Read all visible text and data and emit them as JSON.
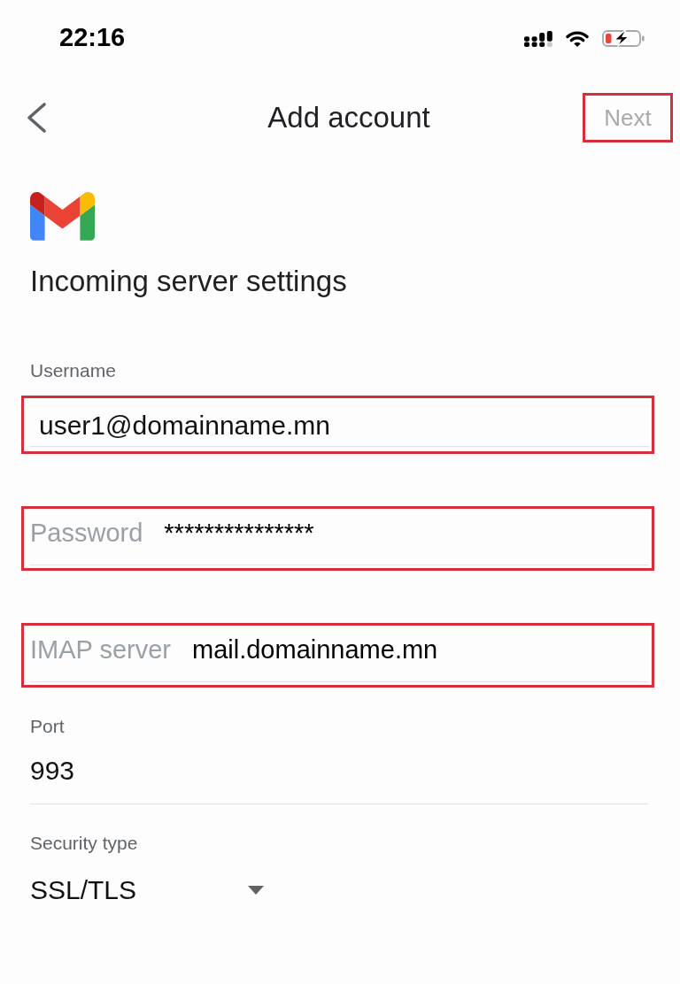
{
  "status_bar": {
    "time": "22:16"
  },
  "nav_bar": {
    "title": "Add account",
    "next_button": {
      "label": "Next",
      "disabled": true,
      "highlighted": true
    }
  },
  "heading": "Incoming server settings",
  "fields": [
    {
      "kind": "stacked",
      "label": "Username",
      "value": "user1@domainname.mn",
      "highlighted": true
    },
    {
      "kind": "inline",
      "label": "Password",
      "value": "***************",
      "highlighted": true
    },
    {
      "kind": "inline",
      "label": "IMAP server",
      "value": "mail.domainname.mn",
      "highlighted": true
    },
    {
      "kind": "stacked",
      "label": "Port",
      "value": "993",
      "highlighted": false
    },
    {
      "kind": "dropdown",
      "label": "Security type",
      "value": "SSL/TLS",
      "highlighted": false
    }
  ]
}
